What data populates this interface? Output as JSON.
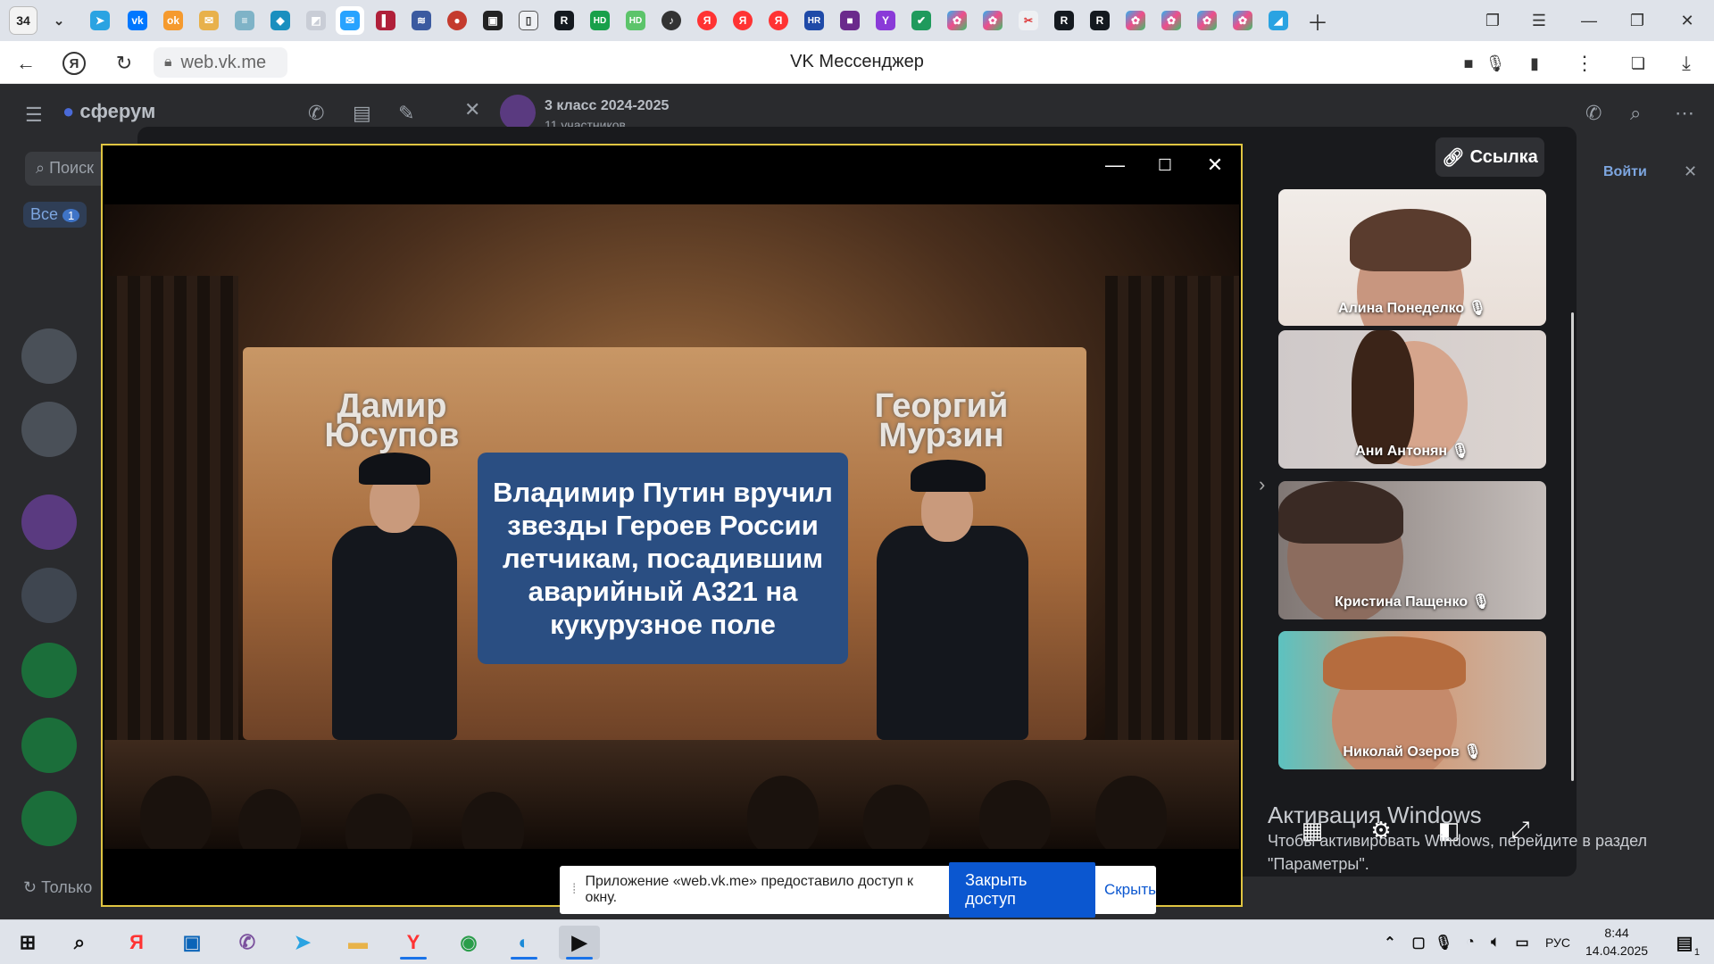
{
  "browser": {
    "tab_count": "34",
    "url": "web.vk.me",
    "title": "VK Мессенджер"
  },
  "vk": {
    "brand": "сферум",
    "search_placeholder": "Поиск",
    "filter_all": "Все",
    "filter_badge": "1",
    "chat_title": "3 класс 2024-2025",
    "chat_subtitle": "11 участников",
    "join_label": "Войти",
    "bottom_label": "Только"
  },
  "call": {
    "link_label": "Ссылка",
    "participants": [
      {
        "name": "Алина Понеделко"
      },
      {
        "name": "Ани Антонян"
      },
      {
        "name": "Кристина Пащенко"
      },
      {
        "name": "Николай Озеров"
      }
    ]
  },
  "video": {
    "headline": "Владимир Путин вручил звезды Героев России летчикам, посадившим аварийный A321 на кукурузное поле",
    "person_left": "Дамир Юсупов",
    "person_right": "Георгий Мурзин"
  },
  "activation": {
    "title": "Активация Windows",
    "subtitle": "Чтобы активировать Windows, перейдите в раздел \"Параметры\"."
  },
  "share_notice": {
    "text": "Приложение «web.vk.me» предоставило доступ к окну.",
    "close_label": "Закрыть доступ",
    "hide_label": "Скрыть"
  },
  "taskbar": {
    "language": "РУС",
    "time": "8:44",
    "date": "14.04.2025",
    "notif_count": "1"
  },
  "colors": {
    "accent": "#0b57d0",
    "window_border": "#e0c542",
    "headline_bg": "#2a4e82"
  }
}
